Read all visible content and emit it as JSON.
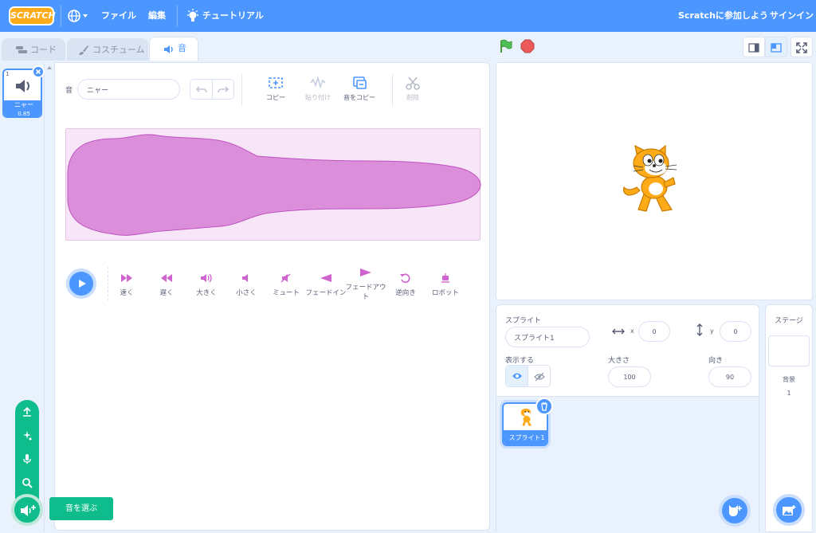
{
  "menubar": {
    "logo_text": "SCRATCH",
    "file": "ファイル",
    "edit": "編集",
    "tutorials": "チュートリアル",
    "join": "Scratchに参加しよう",
    "signin": "サインイン"
  },
  "tabs": {
    "code": "コード",
    "costumes": "コスチューム",
    "sounds": "音"
  },
  "sound_list": [
    {
      "index": "1",
      "name": "ニャー",
      "duration": "0.85"
    }
  ],
  "editor": {
    "sound_label": "音",
    "sound_name": "ニャー",
    "copy": "コピー",
    "paste": "貼り付け",
    "copy_to_new": "音をコピー",
    "delete": "削除"
  },
  "effects": [
    {
      "label": "速く"
    },
    {
      "label": "遅く"
    },
    {
      "label": "大きく"
    },
    {
      "label": "小さく"
    },
    {
      "label": "ミュート"
    },
    {
      "label": "フェードイン"
    },
    {
      "label": "フェードアウト"
    },
    {
      "label": "逆向き"
    },
    {
      "label": "ロボット"
    }
  ],
  "choose_sound_tooltip": "音を選ぶ",
  "sprite_info": {
    "sprite_label": "スプライト",
    "sprite_name": "スプライト1",
    "x_label": "x",
    "x_value": "0",
    "y_label": "y",
    "y_value": "0",
    "show_label": "表示する",
    "size_label": "大きさ",
    "size_value": "100",
    "direction_label": "向き",
    "direction_value": "90"
  },
  "sprites": [
    {
      "name": "スプライト1"
    }
  ],
  "stage_panel": {
    "title": "ステージ",
    "backdrops_label": "背景",
    "backdrops_count": "1"
  },
  "colors": {
    "accent": "#4c97ff",
    "sound_wave": "#cf63cf",
    "add_sound": "#0fbd8c",
    "menubar": "#4c97ff"
  }
}
